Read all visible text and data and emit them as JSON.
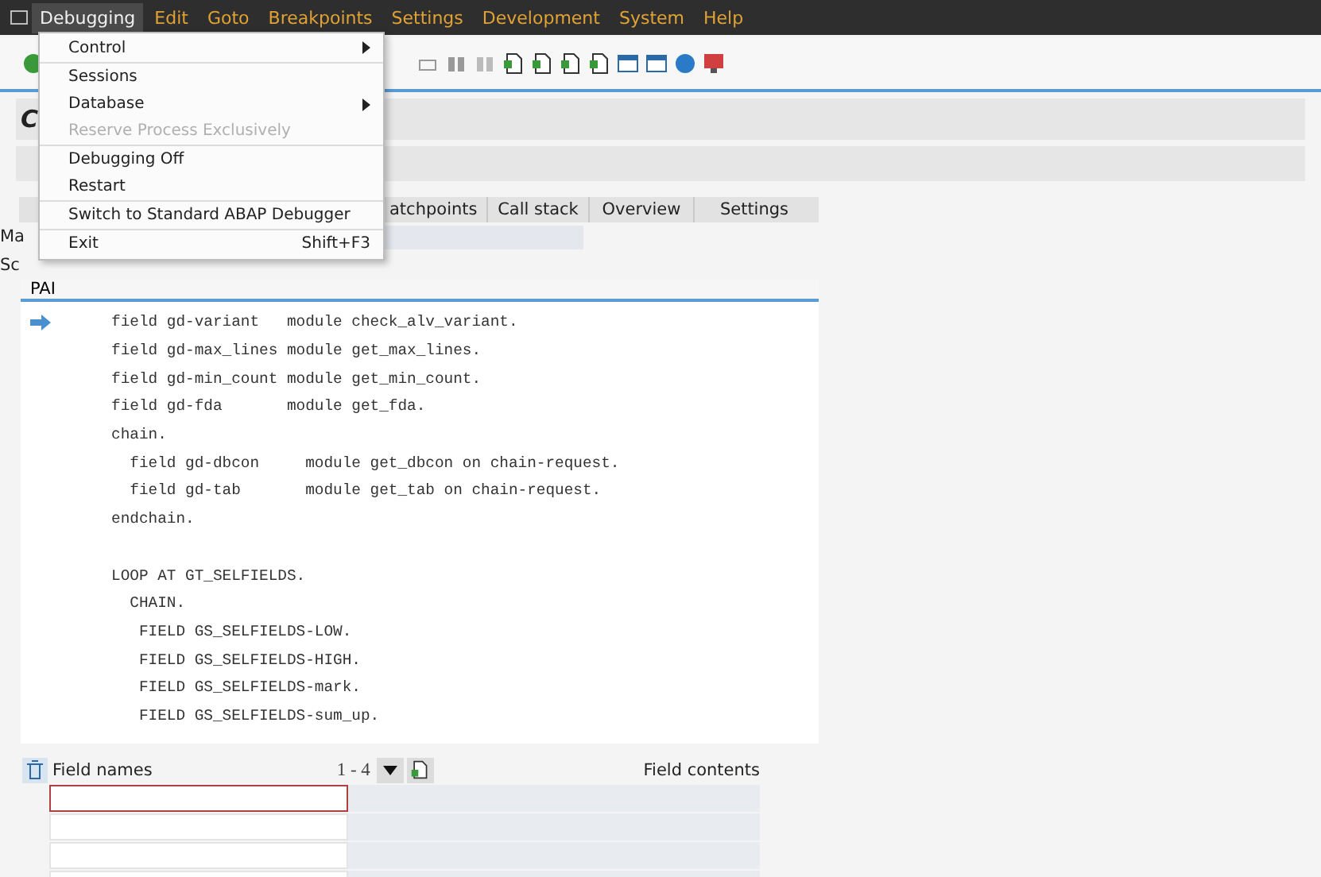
{
  "menu_bar": [
    {
      "label": "Debugging",
      "selected": true
    },
    {
      "label": "Edit",
      "selected": false
    },
    {
      "label": "Goto",
      "selected": false
    },
    {
      "label": "Breakpoints",
      "selected": false
    },
    {
      "label": "Settings",
      "selected": false
    },
    {
      "label": "Development",
      "selected": false
    },
    {
      "label": "System",
      "selected": false
    },
    {
      "label": "Help",
      "selected": false
    }
  ],
  "dropdown": [
    {
      "label": "Control",
      "submenu": true,
      "disabled": false,
      "separator_after": true
    },
    {
      "label": "Sessions",
      "submenu": false,
      "disabled": false,
      "separator_after": false
    },
    {
      "label": "Database",
      "submenu": true,
      "disabled": false,
      "separator_after": false
    },
    {
      "label": "Reserve Process Exclusively",
      "submenu": false,
      "disabled": true,
      "separator_after": true
    },
    {
      "label": "Debugging Off",
      "submenu": false,
      "disabled": false,
      "separator_after": false
    },
    {
      "label": "Restart",
      "submenu": false,
      "disabled": false,
      "separator_after": true
    },
    {
      "label": "Switch to Standard ABAP Debugger",
      "submenu": false,
      "disabled": false,
      "separator_after": true
    },
    {
      "label": "Exit",
      "shortcut": "Shift+F3",
      "submenu": false,
      "disabled": false,
      "separator_after": false
    }
  ],
  "title": "C",
  "tabs": [
    {
      "label": "atchpoints",
      "selected": false
    },
    {
      "label": "Call stack",
      "selected": false
    },
    {
      "label": "Overview",
      "selected": false
    },
    {
      "label": "Settings",
      "selected": false
    }
  ],
  "fields": [
    {
      "label": "Ma"
    },
    {
      "label": "Sc"
    }
  ],
  "code_panel": {
    "title": "PAI",
    "blocks": [
      {
        "lines": [
          {
            "text": "field gd-variant   module check_alv_variant.",
            "current": true
          },
          {
            "text": "field gd-max_lines module get_max_lines.",
            "current": false
          },
          {
            "text": "field gd-min_count module get_min_count.",
            "current": false
          },
          {
            "text": "field gd-fda       module get_fda.",
            "current": false
          },
          {
            "text": "chain.",
            "current": false
          },
          {
            "text": "  field gd-dbcon     module get_dbcon on chain-request.",
            "current": false
          },
          {
            "text": "  field gd-tab       module get_tab on chain-request.",
            "current": false
          },
          {
            "text": "endchain.",
            "current": false
          }
        ]
      },
      {
        "lines": [
          {
            "text": "LOOP AT GT_SELFIELDS.",
            "current": false
          },
          {
            "text": "  CHAIN.",
            "current": false
          },
          {
            "text": "   FIELD GS_SELFIELDS-LOW.",
            "current": false
          },
          {
            "text": "   FIELD GS_SELFIELDS-HIGH.",
            "current": false
          },
          {
            "text": "   FIELD GS_SELFIELDS-mark.",
            "current": false
          },
          {
            "text": "   FIELD GS_SELFIELDS-sum_up.",
            "current": false
          }
        ]
      }
    ]
  },
  "field_table": {
    "names_label": "Field names",
    "range": "1 - 4",
    "contents_label": "Field contents",
    "rows": [
      {
        "focused": true
      },
      {
        "focused": false
      },
      {
        "focused": false
      },
      {
        "focused": false
      }
    ]
  }
}
